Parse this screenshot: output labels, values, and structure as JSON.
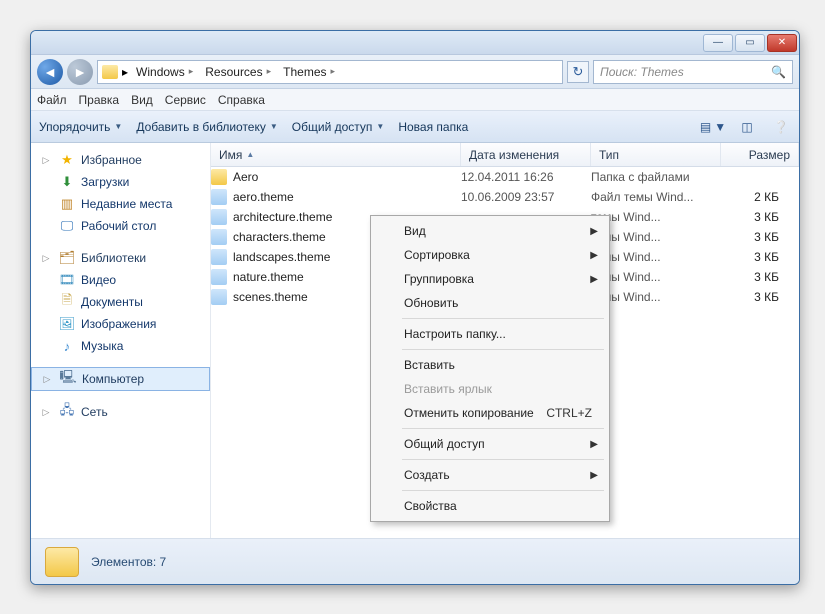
{
  "search": {
    "placeholder": "Поиск: Themes"
  },
  "breadcrumb": [
    "Windows",
    "Resources",
    "Themes"
  ],
  "menubar": [
    "Файл",
    "Правка",
    "Вид",
    "Сервис",
    "Справка"
  ],
  "toolbar": {
    "organize": "Упорядочить",
    "addlib": "Добавить в библиотеку",
    "share": "Общий доступ",
    "newfolder": "Новая папка"
  },
  "sidebar": {
    "favorites": "Избранное",
    "downloads": "Загрузки",
    "recent": "Недавние места",
    "desktop": "Рабочий стол",
    "libraries": "Библиотеки",
    "videos": "Видео",
    "documents": "Документы",
    "pictures": "Изображения",
    "music": "Музыка",
    "computer": "Компьютер",
    "network": "Сеть"
  },
  "columns": {
    "name": "Имя",
    "date": "Дата изменения",
    "type": "Тип",
    "size": "Размер"
  },
  "files": [
    {
      "icon": "folder",
      "name": "Aero",
      "date": "12.04.2011 16:26",
      "type": "Папка с файлами",
      "size": ""
    },
    {
      "icon": "theme",
      "name": "aero.theme",
      "date": "10.06.2009 23:57",
      "type": "Файл темы Wind...",
      "size": "2 КБ"
    },
    {
      "icon": "theme",
      "name": "architecture.theme",
      "date": "",
      "type": "темы Wind...",
      "size": "3 КБ"
    },
    {
      "icon": "theme",
      "name": "characters.theme",
      "date": "",
      "type": "темы Wind...",
      "size": "3 КБ"
    },
    {
      "icon": "theme",
      "name": "landscapes.theme",
      "date": "",
      "type": "темы Wind...",
      "size": "3 КБ"
    },
    {
      "icon": "theme",
      "name": "nature.theme",
      "date": "",
      "type": "темы Wind...",
      "size": "3 КБ"
    },
    {
      "icon": "theme",
      "name": "scenes.theme",
      "date": "",
      "type": "темы Wind...",
      "size": "3 КБ"
    }
  ],
  "ctx": {
    "view": "Вид",
    "sort": "Сортировка",
    "group": "Группировка",
    "refresh": "Обновить",
    "customize": "Настроить папку...",
    "paste": "Вставить",
    "pasteshortcut": "Вставить ярлык",
    "undo": "Отменить копирование",
    "undo_sc": "CTRL+Z",
    "share": "Общий доступ",
    "new": "Создать",
    "props": "Свойства"
  },
  "status": {
    "label": "Элементов: 7"
  }
}
